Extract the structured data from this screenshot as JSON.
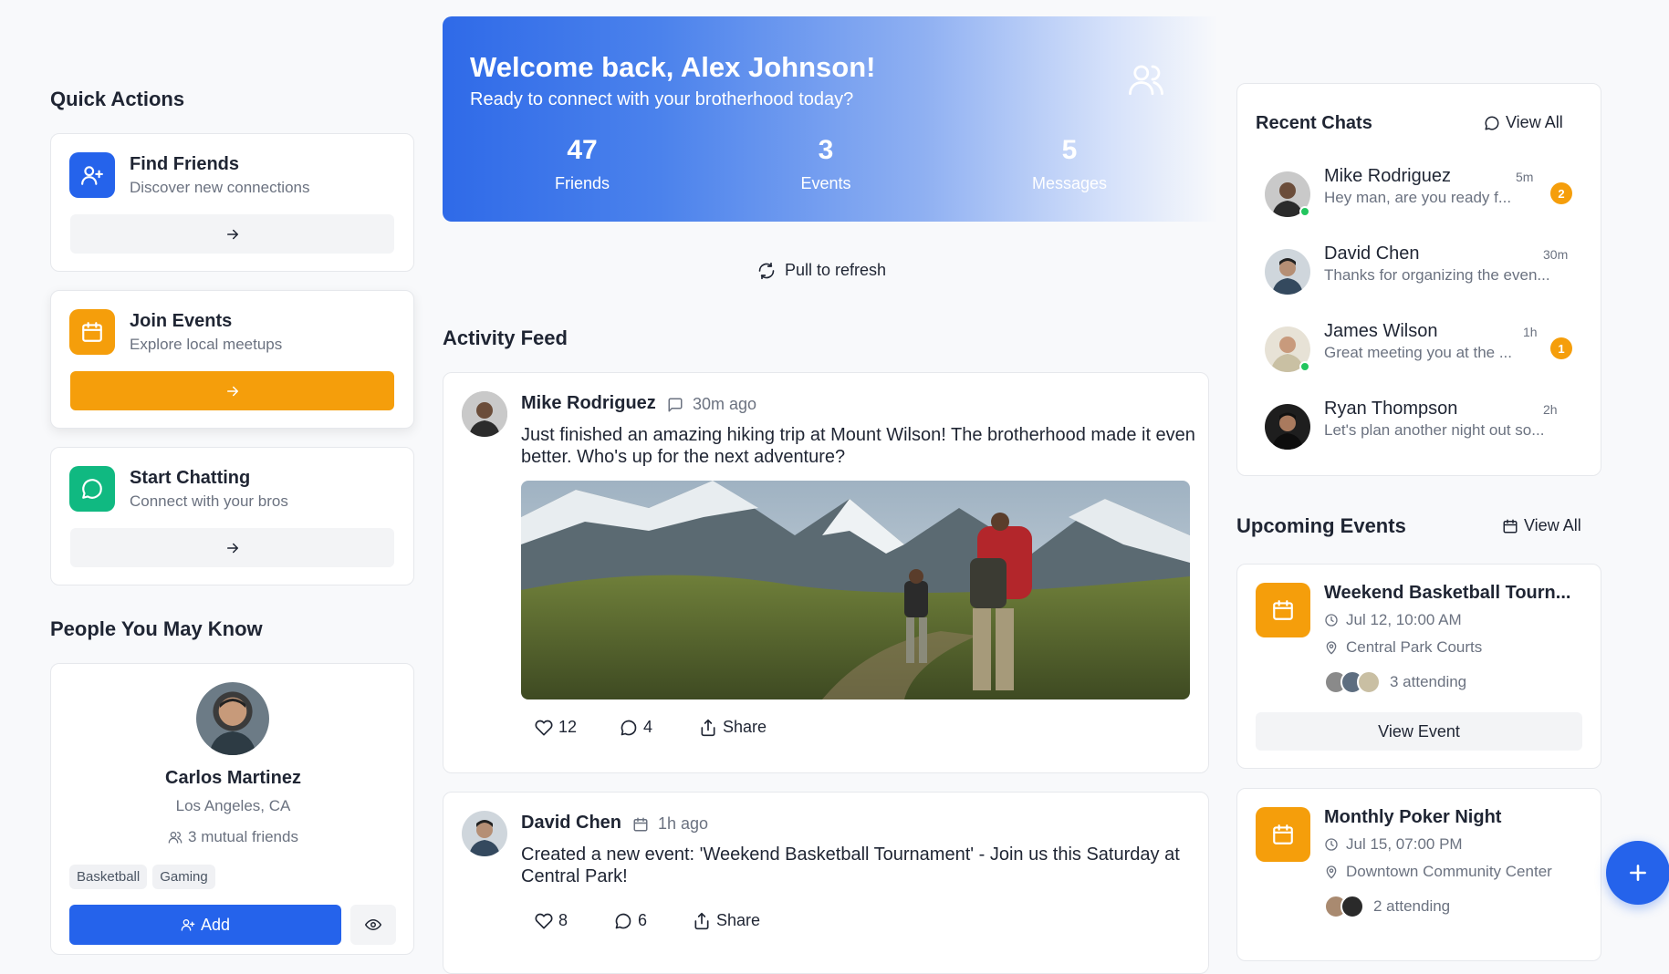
{
  "quick_actions": {
    "title": "Quick Actions",
    "items": [
      {
        "title": "Find Friends",
        "subtitle": "Discover new connections",
        "color": "#2563eb",
        "icon": "user-plus-icon"
      },
      {
        "title": "Join Events",
        "subtitle": "Explore local meetups",
        "color": "#f59e0b",
        "icon": "calendar-icon"
      },
      {
        "title": "Start Chatting",
        "subtitle": "Connect with your bros",
        "color": "#10b981",
        "icon": "chat-bubble-icon"
      }
    ]
  },
  "people": {
    "title": "People You May Know",
    "person": {
      "name": "Carlos Martinez",
      "location": "Los Angeles, CA",
      "mutual": "3 mutual friends",
      "tags": [
        "Basketball",
        "Gaming"
      ],
      "add_label": "Add"
    }
  },
  "welcome": {
    "title": "Welcome back, Alex Johnson!",
    "subtitle": "Ready to connect with your brotherhood today?",
    "stats": [
      {
        "value": "47",
        "label": "Friends"
      },
      {
        "value": "3",
        "label": "Events"
      },
      {
        "value": "5",
        "label": "Messages"
      }
    ]
  },
  "refresh_label": "Pull to refresh",
  "feed": {
    "title": "Activity Feed",
    "posts": [
      {
        "author": "Mike Rodriguez",
        "time": "30m ago",
        "text": "Just finished an amazing hiking trip at Mount Wilson! The brotherhood made it even better. Who's up for the next adventure?",
        "likes": "12",
        "comments": "4",
        "share": "Share"
      },
      {
        "author": "David Chen",
        "time": "1h ago",
        "text": "Created a new event: 'Weekend Basketball Tournament' - Join us this Saturday at Central Park!",
        "likes": "8",
        "comments": "6",
        "share": "Share"
      }
    ]
  },
  "chats": {
    "title": "Recent Chats",
    "view_all": "View All",
    "items": [
      {
        "name": "Mike Rodriguez",
        "message": "Hey man, are you ready f...",
        "time": "5m",
        "unread": "2",
        "online": true
      },
      {
        "name": "David Chen",
        "message": "Thanks for organizing the even...",
        "time": "30m",
        "unread": null,
        "online": false
      },
      {
        "name": "James Wilson",
        "message": "Great meeting you at the ...",
        "time": "1h",
        "unread": "1",
        "online": true
      },
      {
        "name": "Ryan Thompson",
        "message": "Let's plan another night out so...",
        "time": "2h",
        "unread": null,
        "online": false
      }
    ]
  },
  "events": {
    "title": "Upcoming Events",
    "view_all": "View All",
    "items": [
      {
        "title": "Weekend Basketball Tourn...",
        "datetime": "Jul 12, 10:00 AM",
        "location": "Central Park Courts",
        "attending": "3 attending",
        "button": "View Event"
      },
      {
        "title": "Monthly Poker Night",
        "datetime": "Jul 15, 07:00 PM",
        "location": "Downtown Community Center",
        "attending": "2 attending"
      }
    ]
  },
  "colors": {
    "primary": "#2563eb",
    "amber": "#f59e0b",
    "green": "#10b981"
  }
}
